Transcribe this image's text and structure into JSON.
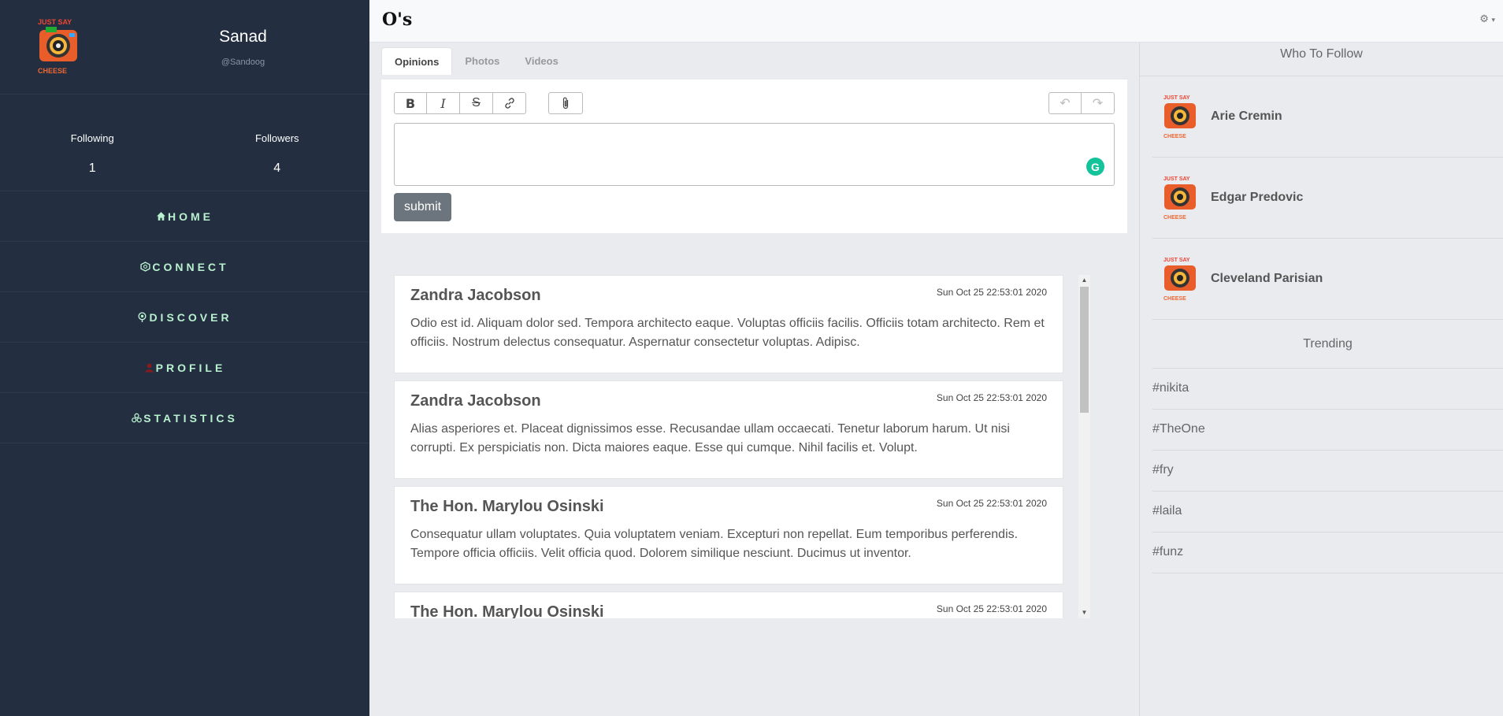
{
  "profile": {
    "name": "Sanad",
    "handle": "@Sandoog",
    "logo_text_top": "JUST SAY",
    "logo_text_bottom": "CHEESE"
  },
  "stats": [
    {
      "label": "Following",
      "value": "1"
    },
    {
      "label": "Followers",
      "value": "4"
    }
  ],
  "nav": [
    {
      "label": "HOME",
      "icon": "home-icon",
      "icon_color": "#b9f0cf"
    },
    {
      "label": "CONNECT",
      "icon": "connect-icon",
      "icon_color": "#b9f0cf"
    },
    {
      "label": "DISCOVER",
      "icon": "discover-icon",
      "icon_color": "#b9f0cf"
    },
    {
      "label": "PROFILE",
      "icon": "profile-icon",
      "icon_color": "#8b1a1a"
    },
    {
      "label": "STATISTICS",
      "icon": "statistics-icon",
      "icon_color": "#b9f0cf"
    }
  ],
  "header": {
    "brand": "O's",
    "settings_icon": "gear-icon"
  },
  "tabs": [
    {
      "label": "Opinions",
      "active": true
    },
    {
      "label": "Photos",
      "active": false
    },
    {
      "label": "Videos",
      "active": false
    }
  ],
  "composer": {
    "submit_label": "submit",
    "toolbar": [
      "bold-icon",
      "italic-icon",
      "strikethrough-icon",
      "link-icon"
    ],
    "attach_icon": "paperclip-icon"
  },
  "posts": [
    {
      "author": "Zandra Jacobson",
      "date": "Sun Oct 25 22:53:01 2020",
      "body": "Odio est id. Aliquam dolor sed. Tempora architecto eaque. Voluptas officiis facilis. Officiis totam architecto. Rem et officiis. Nostrum delectus consequatur. Aspernatur consectetur voluptas. Adipisc."
    },
    {
      "author": "Zandra Jacobson",
      "date": "Sun Oct 25 22:53:01 2020",
      "body": "Alias asperiores et. Placeat dignissimos esse. Recusandae ullam occaecati. Tenetur laborum harum. Ut nisi corrupti. Ex perspiciatis non. Dicta maiores eaque. Esse qui cumque. Nihil facilis et. Volupt."
    },
    {
      "author": "The Hon. Marylou Osinski",
      "date": "Sun Oct 25 22:53:01 2020",
      "body": "Consequatur ullam voluptates. Quia voluptatem veniam. Excepturi non repellat. Eum temporibus perferendis. Tempore officia officiis. Velit officia quod. Dolorem similique nesciunt. Ducimus ut inventor."
    },
    {
      "author": "The Hon. Marylou Osinski",
      "date": "Sun Oct 25 22:53:01 2020",
      "body": ""
    }
  ],
  "who_to_follow": {
    "title": "Who To Follow",
    "users": [
      {
        "name": "Arie Cremin"
      },
      {
        "name": "Edgar Predovic"
      },
      {
        "name": "Cleveland Parisian"
      }
    ]
  },
  "trending": {
    "title": "Trending",
    "tags": [
      "#nikita",
      "#TheOne",
      "#fry",
      "#laila",
      "#funz"
    ]
  }
}
